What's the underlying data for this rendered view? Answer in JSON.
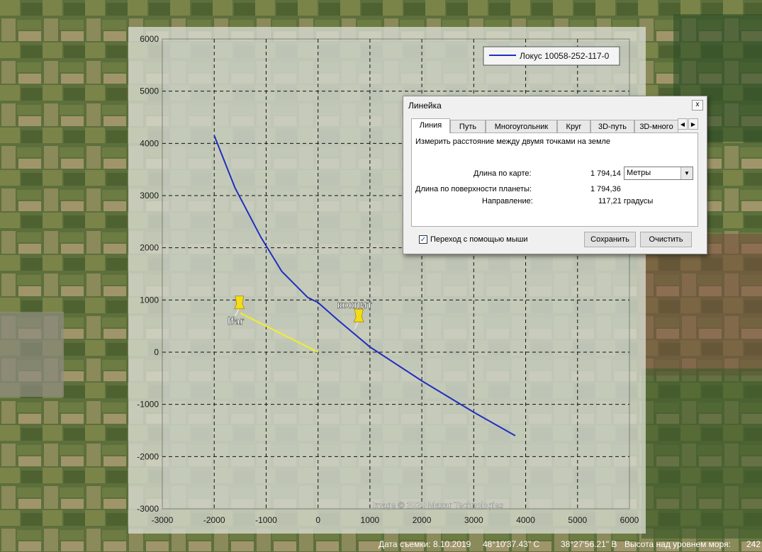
{
  "chart_data": {
    "type": "line",
    "series": [
      {
        "name": "Локус 10058-252-117-0",
        "color": "#1f2fbf",
        "x": [
          -2000,
          -1600,
          -1100,
          -700,
          -200,
          0,
          400,
          1000,
          2000,
          3000,
          3800
        ],
        "y": [
          4150,
          3150,
          2200,
          1550,
          1050,
          950,
          600,
          100,
          -550,
          -1150,
          -1600
        ]
      }
    ],
    "segments": [
      {
        "color": "#f2ee2a",
        "x": [
          -1500,
          0
        ],
        "y": [
          750,
          0
        ]
      }
    ],
    "pins": [
      {
        "label": "lfar",
        "x": -1500,
        "y": 750
      },
      {
        "label": "кокпит",
        "x": 800,
        "y": 500
      }
    ],
    "xticks": [
      "-3000",
      "-2000",
      "-1000",
      "0",
      "1000",
      "2000",
      "3000",
      "4000",
      "5000",
      "6000"
    ],
    "yticks": [
      "6000",
      "5000",
      "4000",
      "3000",
      "2000",
      "1000",
      "0",
      "-1000",
      "-2000",
      "-3000"
    ],
    "xlim": [
      -3000,
      6000
    ],
    "ylim": [
      -3000,
      6000
    ],
    "grid": true,
    "legend_position": "top-right"
  },
  "map": {
    "credit": "Image © 2020 Maxar Technologies"
  },
  "ruler": {
    "title": "Линейка",
    "close": "x",
    "tabs": [
      "Линия",
      "Путь",
      "Многоугольник",
      "Круг",
      "3D-путь",
      "3D-много"
    ],
    "active_tab": 0,
    "description": "Измерить расстояние между двумя точками на земле",
    "map_length_label": "Длина по карте:",
    "map_length_value": "1 794,14",
    "unit_selected": "Метры",
    "surface_length_label": "Длина по поверхности планеты:",
    "surface_length_value": "1 794,36",
    "heading_label": "Направление:",
    "heading_value": "117,21 градусы",
    "mouse_nav_label": "Переход с помощью мыши",
    "mouse_nav_checked": true,
    "save_label": "Сохранить",
    "clear_label": "Очистить"
  },
  "status": {
    "date_label": "Дата съемки: 8.10.2019",
    "lat": "48°10'37.43\" С",
    "lon": "38°27'56.21\" В",
    "elevation_label": "Высота над уровнем моря:",
    "elevation_value": "242"
  },
  "colors": {
    "accent": "#1f2fbf",
    "path": "#f2ee2a"
  }
}
